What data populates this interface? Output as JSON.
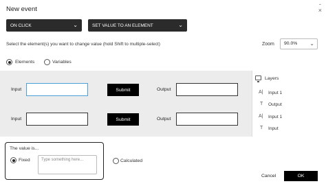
{
  "dialog": {
    "title": "New event"
  },
  "window_icons": {
    "minimize": "-",
    "close": "×"
  },
  "trigger_select": {
    "value": "ON CLICK"
  },
  "action_select": {
    "value": "SET VALUE TO AN ELEMENT"
  },
  "hint": "Select the element(s) you want to change value (hold Shift to multiple-select)",
  "zoom": {
    "label": "Zoom",
    "value": "90.0%"
  },
  "mode_radios": [
    {
      "label": "Elements",
      "selected": true
    },
    {
      "label": "Variables",
      "selected": false
    }
  ],
  "canvas": {
    "rows": [
      {
        "input_label": "Input",
        "button_label": "Submit",
        "output_label": "Output"
      },
      {
        "input_label": "Input",
        "button_label": "Submit",
        "output_label": "Output"
      }
    ]
  },
  "layers": {
    "title": "Layers",
    "items": [
      {
        "label": "Input 1",
        "icon": "text-input-icon"
      },
      {
        "label": "Output",
        "icon": "text-icon"
      },
      {
        "label": "Input 1",
        "icon": "text-input-icon"
      },
      {
        "label": "Input",
        "icon": "text-icon"
      }
    ]
  },
  "value_section": {
    "title": "The value is...",
    "fixed_label": "Fixed",
    "placeholder": "Type something here...",
    "calculated_label": "Calculated"
  },
  "footer": {
    "cancel": "Cancel",
    "ok": "OK"
  },
  "colors": {
    "accent_selection": "#4a9fd8",
    "button_bg": "#000000",
    "select_bg": "#2b2b2b"
  }
}
